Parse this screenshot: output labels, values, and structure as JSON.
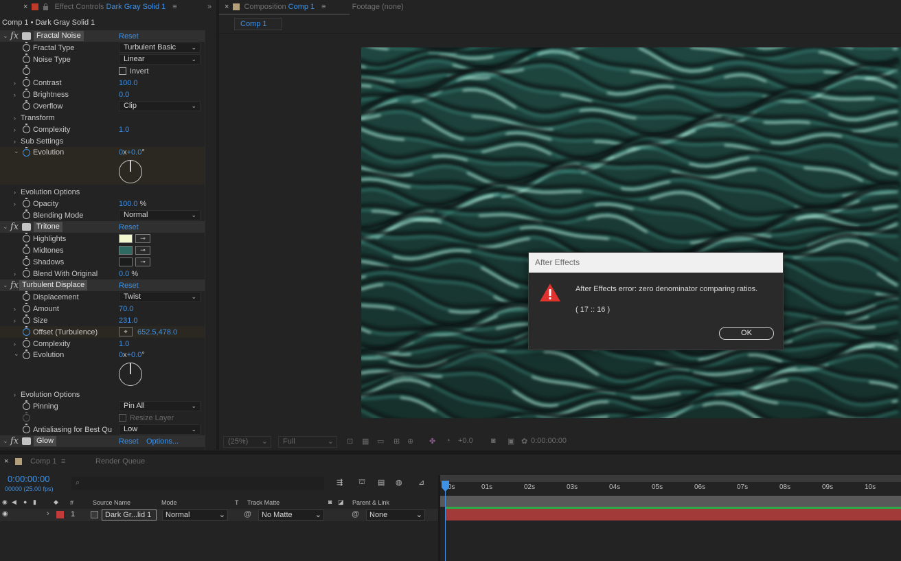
{
  "effect_controls_tab": {
    "prefix": "Effect Controls",
    "layer": "Dark Gray Solid 1"
  },
  "composition_tab": {
    "prefix": "Composition",
    "name": "Comp 1"
  },
  "footage_tab": {
    "label": "Footage  (none)"
  },
  "comp_subtab": {
    "label": "Comp 1"
  },
  "ec_header": {
    "label": "Comp 1 • Dark Gray Solid 1"
  },
  "effects": {
    "fractal_noise": {
      "name": "Fractal Noise",
      "reset": "Reset",
      "fractal_type_label": "Fractal Type",
      "fractal_type": "Turbulent Basic",
      "noise_type_label": "Noise Type",
      "noise_type": "Linear",
      "invert_label": "Invert",
      "contrast_label": "Contrast",
      "contrast": "100.0",
      "brightness_label": "Brightness",
      "brightness": "0.0",
      "overflow_label": "Overflow",
      "overflow": "Clip",
      "transform_label": "Transform",
      "complexity_label": "Complexity",
      "complexity": "1.0",
      "sub_settings_label": "Sub Settings",
      "evolution_label": "Evolution",
      "evolution_rev": "0",
      "evolution_x": "x",
      "evolution_deg": "+0.0",
      "evolution_unit": "°",
      "evolution_options_label": "Evolution Options",
      "opacity_label": "Opacity",
      "opacity": "100.0",
      "opacity_unit": "%",
      "blending_mode_label": "Blending Mode",
      "blending_mode": "Normal"
    },
    "tritone": {
      "name": "Tritone",
      "reset": "Reset",
      "highlights_label": "Highlights",
      "highlights_color": "#f4f8cf",
      "midtones_label": "Midtones",
      "midtones_color": "#2f6a62",
      "shadows_label": "Shadows",
      "shadows_color": "#1a1d1c",
      "blend_label": "Blend With Original",
      "blend": "0.0",
      "blend_unit": "%"
    },
    "turbulent_displace": {
      "name": "Turbulent Displace",
      "reset": "Reset",
      "displacement_label": "Displacement",
      "displacement": "Twist",
      "amount_label": "Amount",
      "amount": "70.0",
      "size_label": "Size",
      "size": "231.0",
      "offset_label": "Offset (Turbulence)",
      "offset_x": "652.5",
      "offset_y": "478.0",
      "complexity_label": "Complexity",
      "complexity": "1.0",
      "evolution_label": "Evolution",
      "evolution_rev": "0",
      "evolution_x": "x",
      "evolution_deg": "+0.0",
      "evolution_unit": "°",
      "evolution_options_label": "Evolution Options",
      "pinning_label": "Pinning",
      "pinning": "Pin All",
      "resize_label": "Resize Layer",
      "antialiasing_label": "Antialiasing for Best Qu",
      "antialiasing": "Low"
    },
    "glow": {
      "name": "Glow",
      "reset": "Reset",
      "options": "Options..."
    }
  },
  "dialog": {
    "title": "After Effects",
    "message": "After Effects error: zero denominator comparing ratios.",
    "code": "( 17 :: 16 )",
    "ok": "OK"
  },
  "viewer_toolbar": {
    "zoom": "(25%)",
    "resolution": "Full",
    "exposure": "+0.0",
    "timecode": "0:00:00:00"
  },
  "timeline": {
    "tab": "Comp 1",
    "render_queue": "Render Queue",
    "timecode": "0:00:00:00",
    "frames": "00000 (25.00 fps)",
    "columns": {
      "num": "#",
      "source": "Source Name",
      "mode": "Mode",
      "t": "T",
      "track_matte": "Track Matte",
      "parent": "Parent & Link"
    },
    "layer": {
      "num": "1",
      "name": "Dark Gr...lid 1",
      "mode": "Normal",
      "matte": "No Matte",
      "parent": "None"
    },
    "ruler": [
      "0s",
      "01s",
      "02s",
      "03s",
      "04s",
      "05s",
      "06s",
      "07s",
      "08s",
      "09s",
      "10s"
    ]
  },
  "colors": {
    "accent": "#3d92e8",
    "layer_red": "#c23a3a",
    "dialog_error": "#e0332f"
  }
}
